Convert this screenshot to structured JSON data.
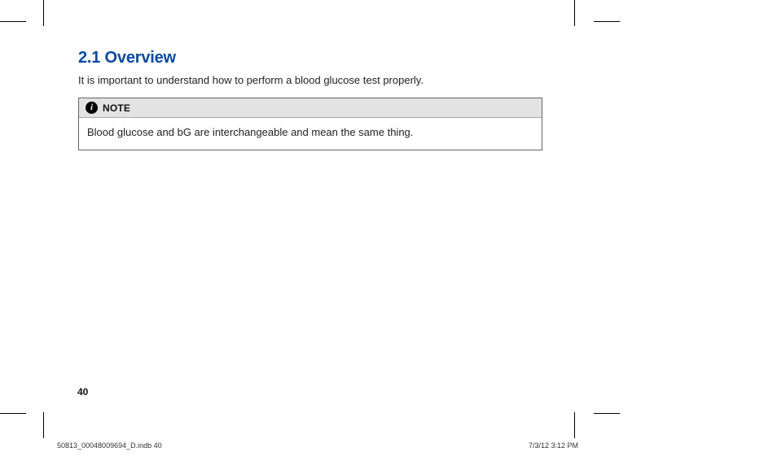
{
  "heading": "2.1 Overview",
  "intro_text": "It is important to understand how to perform a blood glucose test properly.",
  "note": {
    "label": "NOTE",
    "icon_glyph": "i",
    "body": "Blood glucose and bG are interchangeable and mean the same thing."
  },
  "page_number": "40",
  "footer": {
    "left": "50813_00048009694_D.indb   40",
    "right": "7/3/12   3:12 PM"
  }
}
